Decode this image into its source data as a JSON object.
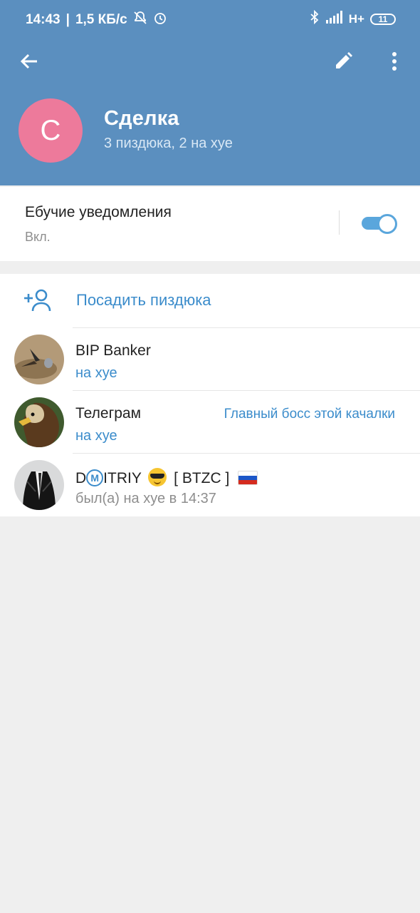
{
  "status_bar": {
    "time": "14:43",
    "separator": "|",
    "speed": "1,5 КБ/с",
    "network": "H+",
    "battery": "11",
    "icons": [
      "mute-bell-icon",
      "alarm-icon",
      "bluetooth-icon",
      "signal-icon"
    ]
  },
  "header": {
    "avatar_letter": "С",
    "title": "Сделка",
    "subtitle": "3 пиздюка, 2 на хуе",
    "accent_color": "#5b8fbf",
    "avatar_color": "#ed7a9b"
  },
  "notifications": {
    "title": "Ебучие уведомления",
    "state": "Вкл.",
    "enabled": true
  },
  "add_member": {
    "label": "Посадить пиздюка"
  },
  "members": [
    {
      "name": "BIP Banker",
      "status": "на хуе",
      "online": true,
      "role": ""
    },
    {
      "name": "Телеграм",
      "status": "на хуе",
      "online": true,
      "role": "Главный босс этой качалки"
    },
    {
      "name_prefix": "D",
      "name_circled": "M",
      "name_rest": "ITRIY",
      "name_tag": "[ BTZC ]",
      "status": "был(а) на хуе в 14:37",
      "online": false,
      "role": ""
    }
  ],
  "accent_link_color": "#3b8ccb"
}
